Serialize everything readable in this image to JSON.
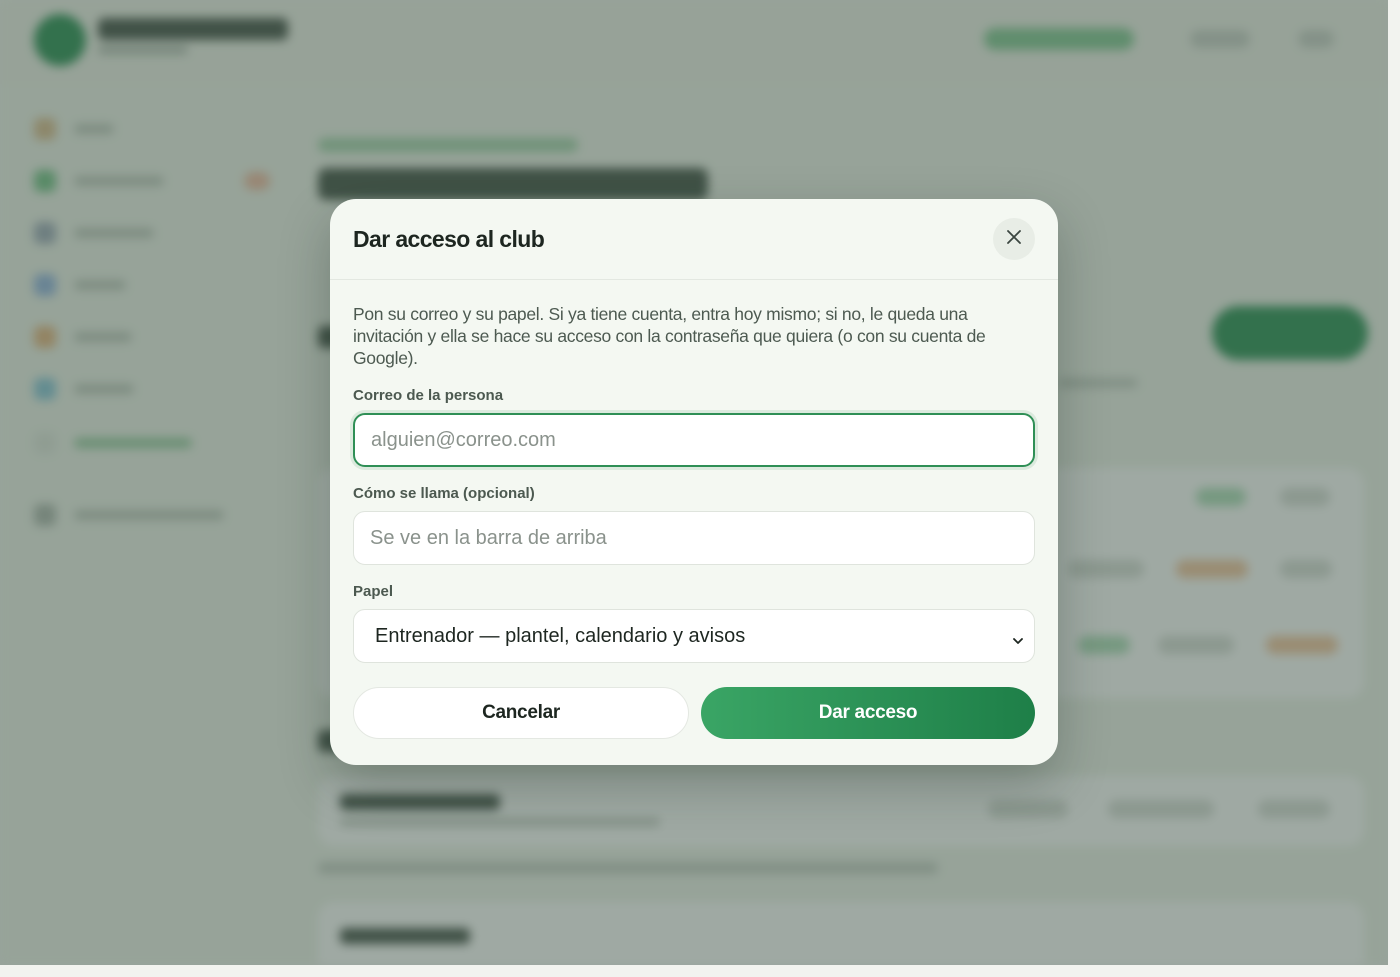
{
  "modal": {
    "title": "Dar acceso al club",
    "intro": "Pon su correo y su papel. Si ya tiene cuenta, entra hoy mismo; si no, le queda una invitación y ella se hace su acceso con la contraseña que quiera (o con su cuenta de Google).",
    "email": {
      "label": "Correo de la persona",
      "value": "",
      "placeholder": "alguien@correo.com"
    },
    "name": {
      "label": "Cómo se llama (opcional)",
      "value": "",
      "placeholder": "Se ve en la barra de arriba"
    },
    "role": {
      "label": "Papel",
      "selected": "Entrenador — plantel, calendario y avisos"
    },
    "cancel_label": "Cancelar",
    "submit_label": "Dar acceso"
  },
  "colors": {
    "accent": "#2f8f56",
    "accent_dark": "#1e7f48",
    "modal_bg": "#f4f8f2"
  },
  "icons": {
    "close": "close-icon",
    "select_caret": "chevron-down-icon"
  }
}
